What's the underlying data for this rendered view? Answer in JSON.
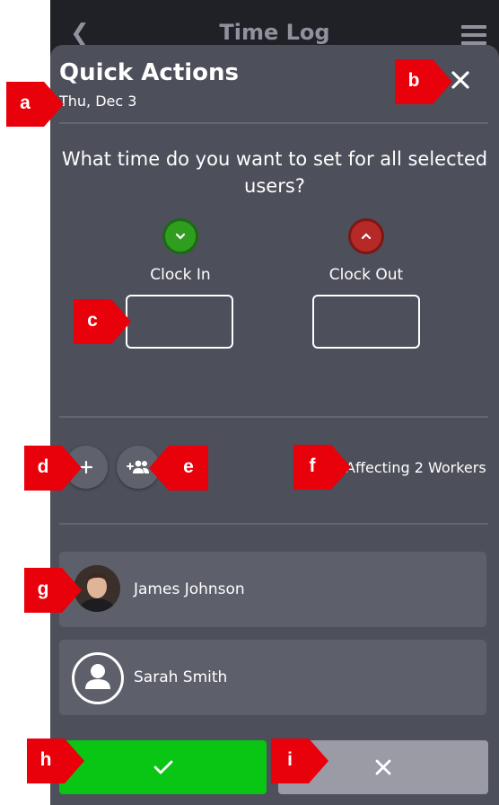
{
  "background": {
    "title": "Time Log",
    "back_icon": "chevron-left-icon",
    "menu_icon": "hamburger-menu-icon"
  },
  "quick_actions": {
    "title": "Quick Actions",
    "date": "Thu, Dec 3",
    "question": "What time do you want to set for all selected users?",
    "clock_in": {
      "label": "Clock In",
      "value": "",
      "icon": "chevron-down-icon",
      "color": "#2f9e1f"
    },
    "clock_out": {
      "label": "Clock Out",
      "value": "",
      "icon": "chevron-up-icon",
      "color": "#b52a26"
    },
    "add_icon": "plus-icon",
    "add_workers_icon": "add-group-icon",
    "affecting": "Affecting 2 Workers",
    "workers": [
      {
        "name": "James Johnson",
        "avatar": "photo"
      },
      {
        "name": "Sarah Smith",
        "avatar": "placeholder-user-icon"
      }
    ],
    "confirm_icon": "check-icon",
    "cancel_icon": "close-icon"
  },
  "callouts": {
    "a": "a",
    "b": "b",
    "c": "c",
    "d": "d",
    "e": "e",
    "f": "f",
    "g": "g",
    "h": "h",
    "i": "i",
    "color": "#e8000b"
  }
}
